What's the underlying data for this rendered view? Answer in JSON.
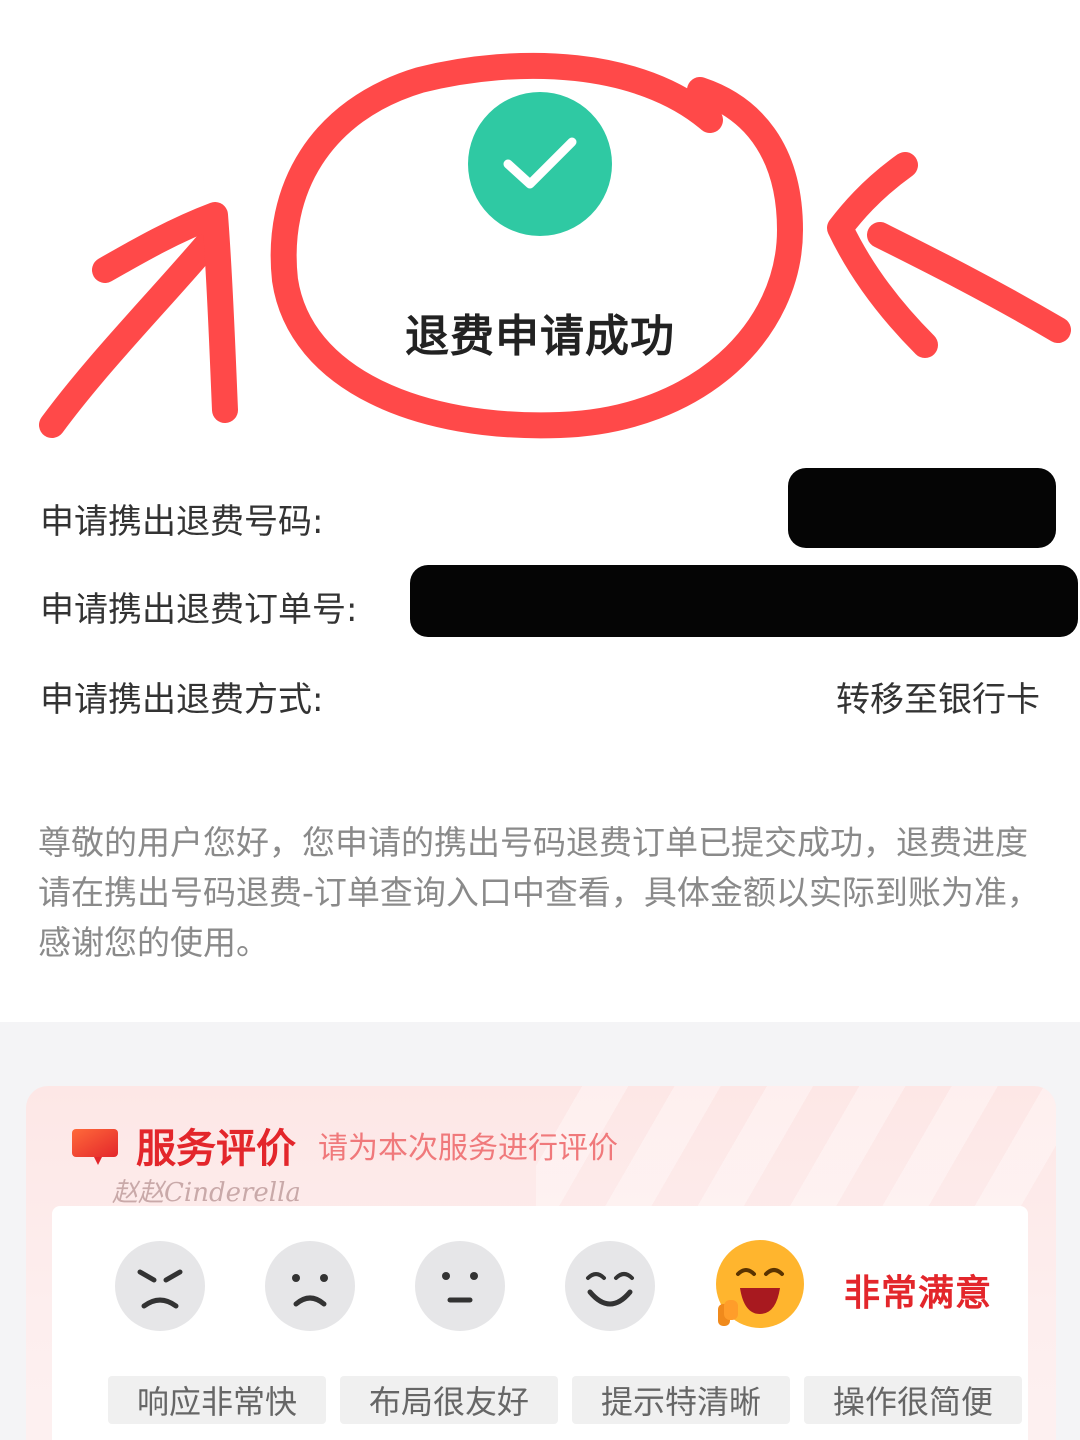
{
  "result": {
    "title": "退费申请成功",
    "status_icon": "check-icon",
    "status_color": "#2fc9a3"
  },
  "info": [
    {
      "label": "申请携出退费号码:",
      "value": ""
    },
    {
      "label": "申请携出退费订单号:",
      "value": ""
    },
    {
      "label": "申请携出退费方式:",
      "value": "转移至银行卡"
    }
  ],
  "notice": "尊敬的用户您好，您申请的携出号码退费订单已提交成功，退费进度请在携出号码退费-订单查询入口中查看，具体金额以实际到账为准，感谢您的使用。",
  "evaluation": {
    "title": "服务评价",
    "subtitle": "请为本次服务进行评价",
    "watermark": "赵赵Cinderella",
    "selected_label": "非常满意",
    "faces": [
      "angry-face-icon",
      "sad-face-icon",
      "neutral-face-icon",
      "smile-face-icon",
      "grin-face-icon"
    ],
    "tags": [
      "响应非常快",
      "布局很友好",
      "提示特清晰",
      "操作很简便"
    ],
    "accent_color": "#e3262b"
  }
}
